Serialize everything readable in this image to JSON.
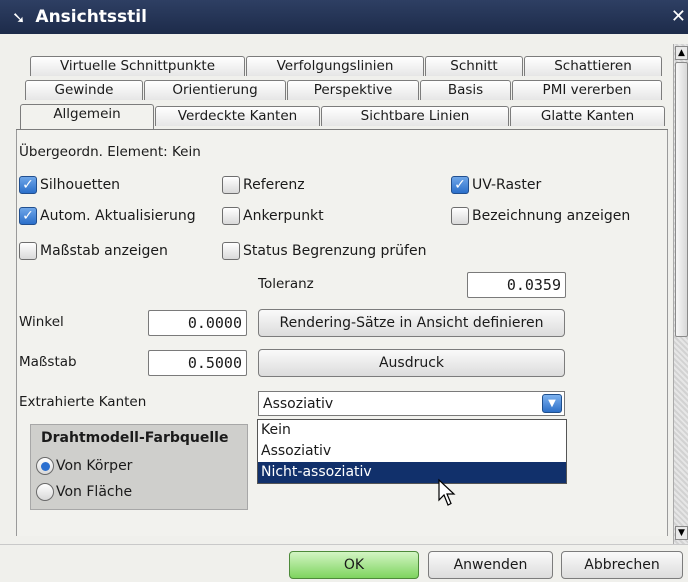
{
  "window": {
    "title": "Ansichtsstil"
  },
  "tabs": {
    "row1": [
      "Virtuelle Schnittpunkte",
      "Verfolgungslinien",
      "Schnitt",
      "Schattieren"
    ],
    "row2": [
      "Gewinde",
      "Orientierung",
      "Perspektive",
      "Basis",
      "PMI vererben"
    ],
    "row3": [
      "Allgemein",
      "Verdeckte Kanten",
      "Sichtbare Linien",
      "Glatte Kanten"
    ]
  },
  "parent_element": "Übergeordn. Element: Kein",
  "checkboxes": {
    "silhouetten": {
      "label": "Silhouetten",
      "checked": true
    },
    "referenz": {
      "label": "Referenz",
      "checked": false
    },
    "uv_raster": {
      "label": "UV-Raster",
      "checked": true
    },
    "autom": {
      "label": "Autom. Aktualisierung",
      "checked": true
    },
    "ankerpunkt": {
      "label": "Ankerpunkt",
      "checked": false
    },
    "bezeichnung": {
      "label": "Bezeichnung anzeigen",
      "checked": false
    },
    "massstab_anzeigen": {
      "label": "Maßstab anzeigen",
      "checked": false
    },
    "status": {
      "label": "Status Begrenzung prüfen",
      "checked": false
    }
  },
  "toleranz": {
    "label": "Toleranz",
    "value": "0.0359"
  },
  "winkel": {
    "label": "Winkel",
    "value": "0.0000"
  },
  "massstab": {
    "label": "Maßstab",
    "value": "0.5000"
  },
  "buttons": {
    "rendering": "Rendering-Sätze in Ansicht definieren",
    "ausdruck": "Ausdruck",
    "ok": "OK",
    "anwenden": "Anwenden",
    "abbrechen": "Abbrechen"
  },
  "extrahierte": {
    "label": "Extrahierte Kanten",
    "selected": "Assoziativ",
    "options": [
      "Kein",
      "Assoziativ",
      "Nicht-assoziativ"
    ],
    "highlighted": "Nicht-assoziativ"
  },
  "drahtmodell": {
    "title": "Drahtmodell-Farbquelle",
    "options": [
      "Von Körper",
      "Von Fläche"
    ],
    "selected": "Von Körper"
  },
  "colors": {
    "title_bar": "#1d2b4a",
    "highlight": "#11306b",
    "check": "#2b6fca",
    "ok_button": "#7ed45f"
  }
}
